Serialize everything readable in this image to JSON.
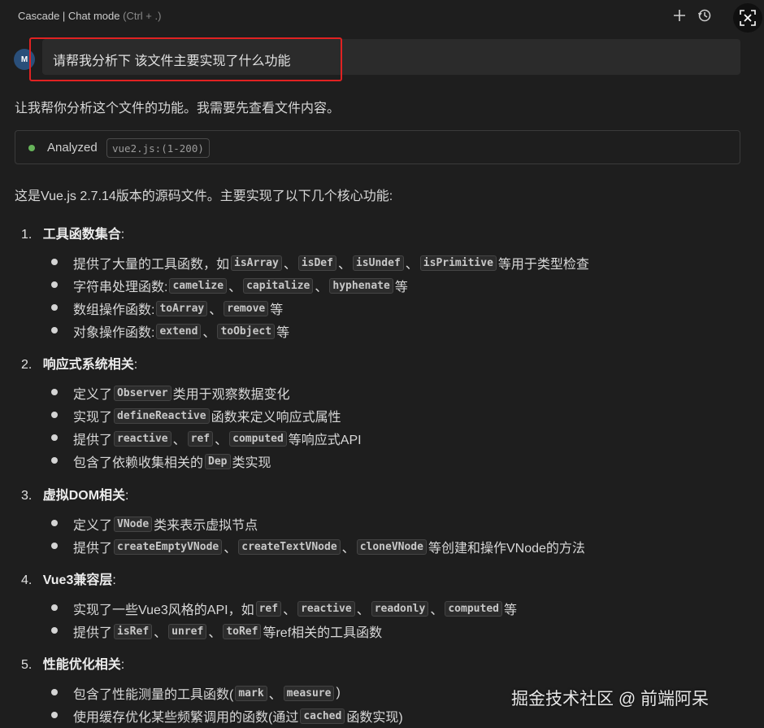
{
  "header": {
    "title": "Cascade | Chat mode",
    "shortcut_hint": "(Ctrl + .)",
    "icons": [
      "plus-icon",
      "history-icon",
      "close-icon"
    ]
  },
  "user": {
    "avatar_initials": "M",
    "message": "请帮我分析下 该文件主要实现了什么功能"
  },
  "assistant": {
    "intro": "让我帮你分析这个文件的功能。我需要先查看文件内容。",
    "analyzed_label": "Analyzed",
    "analyzed_file": "vue2.js:(1-200)",
    "summary": "这是Vue.js 2.7.14版本的源码文件。主要实现了以下几个核心功能:",
    "sections": [
      {
        "num": "1.",
        "title": "工具函数集合",
        "colon": ":"
      },
      {
        "num": "2.",
        "title": "响应式系统相关",
        "colon": ":"
      },
      {
        "num": "3.",
        "title": "虚拟DOM相关",
        "colon": ":"
      },
      {
        "num": "4.",
        "title": "Vue3兼容层",
        "colon": ":"
      },
      {
        "num": "5.",
        "title": "性能优化相关",
        "colon": ":"
      }
    ],
    "lines": {
      "s1l1": {
        "a": "提供了大量的工具函数，如",
        "c1": "isArray",
        "s1": "、",
        "c2": "isDef",
        "s2": "、",
        "c3": "isUndef",
        "s3": "、",
        "c4": "isPrimitive",
        "b": "等用于类型检查"
      },
      "s1l2": {
        "a": "字符串处理函数:",
        "c1": "camelize",
        "s1": "、",
        "c2": "capitalize",
        "s2": "、",
        "c3": "hyphenate",
        "b": "等"
      },
      "s1l3": {
        "a": "数组操作函数:",
        "c1": "toArray",
        "s1": "、",
        "c2": "remove",
        "b": "等"
      },
      "s1l4": {
        "a": "对象操作函数:",
        "c1": "extend",
        "s1": "、",
        "c2": "toObject",
        "b": "等"
      },
      "s2l1": {
        "a": "定义了",
        "c1": "Observer",
        "b": "类用于观察数据变化"
      },
      "s2l2": {
        "a": "实现了",
        "c1": "defineReactive",
        "b": "函数来定义响应式属性"
      },
      "s2l3": {
        "a": "提供了",
        "c1": "reactive",
        "s1": "、",
        "c2": "ref",
        "s2": "、",
        "c3": "computed",
        "b": "等响应式API"
      },
      "s2l4": {
        "a": "包含了依赖收集相关的",
        "c1": "Dep",
        "b": "类实现"
      },
      "s3l1": {
        "a": "定义了",
        "c1": "VNode",
        "b": "类来表示虚拟节点"
      },
      "s3l2": {
        "a": "提供了",
        "c1": "createEmptyVNode",
        "s1": "、",
        "c2": "createTextVNode",
        "s2": "、",
        "c3": "cloneVNode",
        "b": "等创建和操作VNode的方法"
      },
      "s4l1": {
        "a": "实现了一些Vue3风格的API，如",
        "c1": "ref",
        "s1": "、",
        "c2": "reactive",
        "s2": "、",
        "c3": "readonly",
        "s3": "、",
        "c4": "computed",
        "b": "等"
      },
      "s4l2": {
        "a": "提供了",
        "c1": "isRef",
        "s1": "、",
        "c2": "unref",
        "s2": "、",
        "c3": "toRef",
        "b": "等ref相关的工具函数"
      },
      "s5l1": {
        "a": "包含了性能测量的工具函数(",
        "c1": "mark",
        "s1": "、",
        "c2": "measure",
        "b": ")"
      },
      "s5l2": {
        "a": "使用缓存优化某些频繁调用的函数(通过",
        "c1": "cached",
        "b": "函数实现)"
      }
    }
  },
  "watermark": "掘金技术社区 @ 前端阿呆",
  "colors": {
    "highlight_box": "#e02222",
    "status_dot": "#67b45a",
    "background": "#1e1e1e"
  }
}
